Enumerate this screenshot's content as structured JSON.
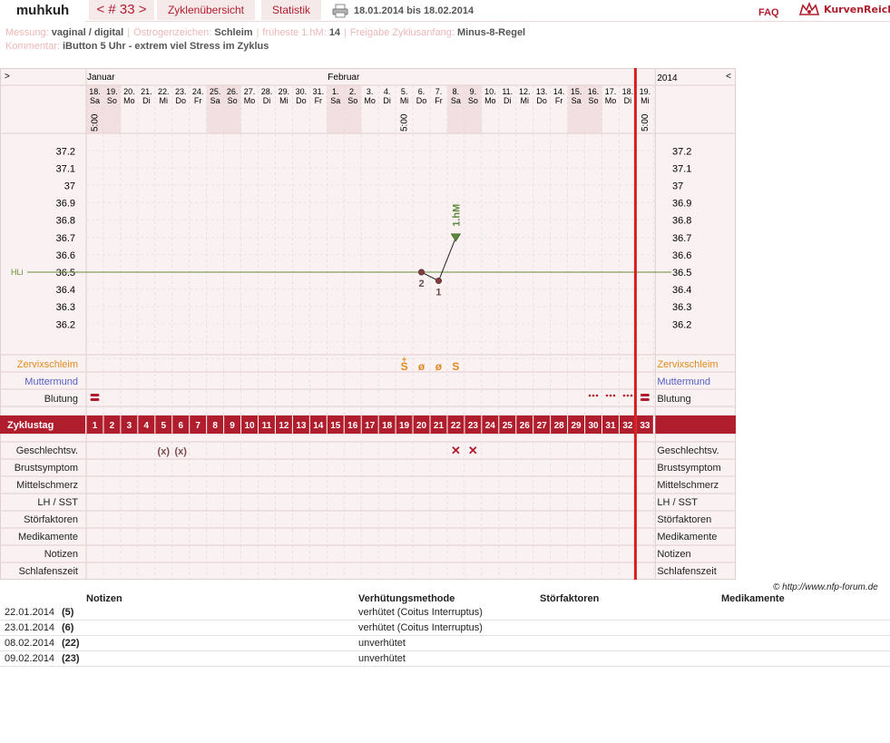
{
  "header": {
    "user": "muhkuh",
    "cycle": "< # 33 >",
    "tab_overview": "Zyklenübersicht",
    "tab_stats": "Statistik",
    "date_range": "18.01.2014 bis 18.02.2014",
    "faq": "FAQ",
    "logo_text": "KurvenReich"
  },
  "info": {
    "messung_label": "Messung:",
    "messung_value": "vaginal / digital",
    "oestrogen_label": "Östrogenzeichen:",
    "oestrogen_value": "Schleim",
    "hm_label": "früheste 1.hM:",
    "hm_value": "14",
    "freigabe_label": "Freigabe Zyklusanfang:",
    "freigabe_value": "Minus-8-Regel",
    "kommentar_label": "Kommentar:",
    "kommentar_value": "iButton 5 Uhr -  extrem viel Stress im Zyklus"
  },
  "colors": {
    "accent": "#b01e2e",
    "weekend_bg": "#f1dfe1",
    "grid_bg": "#faf2f2",
    "coverline": "#6b8e3a",
    "cervix": "#e08a1e",
    "muttermund": "#5560c0",
    "temp_line": "#222222",
    "hm_marker": "#5f8a3c"
  },
  "chart_data": {
    "type": "line",
    "year": "2014",
    "nav_left": ">",
    "nav_right": "<",
    "month_labels": [
      {
        "day_index": 1,
        "text": "Januar"
      },
      {
        "day_index": 15,
        "text": "Februar"
      }
    ],
    "dates": [
      "18.",
      "19.",
      "20.",
      "21.",
      "22.",
      "23.",
      "24.",
      "25.",
      "26.",
      "27.",
      "28.",
      "29.",
      "30.",
      "31.",
      "1.",
      "2.",
      "3.",
      "4.",
      "5.",
      "6.",
      "7.",
      "8.",
      "9.",
      "10.",
      "11.",
      "12.",
      "13.",
      "14.",
      "15.",
      "16.",
      "17.",
      "18.",
      "19."
    ],
    "weekdays": [
      "Sa",
      "So",
      "Mo",
      "Di",
      "Mi",
      "Do",
      "Fr",
      "Sa",
      "So",
      "Mo",
      "Di",
      "Mi",
      "Do",
      "Fr",
      "Sa",
      "So",
      "Mo",
      "Di",
      "Mi",
      "Do",
      "Fr",
      "Sa",
      "So",
      "Mo",
      "Di",
      "Mi",
      "Do",
      "Fr",
      "Sa",
      "So",
      "Mo",
      "Di",
      "Mi"
    ],
    "weekend_cycle_days": [
      1,
      2,
      8,
      9,
      15,
      16,
      22,
      23,
      29,
      30
    ],
    "time_labels": [
      {
        "cycle_day": 1,
        "text": "5:00"
      },
      {
        "cycle_day": 19,
        "text": "5:00"
      },
      {
        "cycle_day": 33,
        "text": "5:00"
      }
    ],
    "cycle_days": [
      1,
      2,
      3,
      4,
      5,
      6,
      7,
      8,
      9,
      10,
      11,
      12,
      13,
      14,
      15,
      16,
      17,
      18,
      19,
      20,
      21,
      22,
      23,
      24,
      25,
      26,
      27,
      28,
      29,
      30,
      31,
      32,
      33
    ],
    "today_cycle_day": 33,
    "ylim": [
      36.1,
      37.3
    ],
    "y_ticks": [
      "37.2",
      "37.1",
      "37",
      "36.9",
      "36.8",
      "36.7",
      "36.6",
      "36.5",
      "36.4",
      "36.3",
      "36.2"
    ],
    "coverline": {
      "value": 36.5,
      "label": "HLi"
    },
    "series": [
      {
        "points": [
          {
            "cycle_day": 20,
            "temp": 36.5
          },
          {
            "cycle_day": 21,
            "temp": 36.45
          },
          {
            "cycle_day": 22,
            "temp": 36.7
          }
        ]
      }
    ],
    "point_labels": [
      {
        "cycle_day": 20,
        "text": "2"
      },
      {
        "cycle_day": 21,
        "text": "1"
      }
    ],
    "hm_marker": {
      "cycle_day": 22,
      "text": "1.hM"
    },
    "row_labels": {
      "zervix": "Zervixschleim",
      "muttermund": "Muttermund",
      "blutung": "Blutung",
      "zyklustag": "Zyklustag",
      "geschlechtsverkehr": "Geschlechtsv.",
      "brust": "Brustsymptom",
      "mittelschmerz": "Mittelschmerz",
      "lh": "LH / SST",
      "stoer": "Störfaktoren",
      "medi": "Medikamente",
      "notizen": "Notizen",
      "schlaf": "Schlafenszeit"
    },
    "cervix": [
      {
        "cycle_day": 19,
        "text": "S",
        "mark": "+"
      },
      {
        "cycle_day": 20,
        "text": "ø"
      },
      {
        "cycle_day": 21,
        "text": "ø"
      },
      {
        "cycle_day": 22,
        "text": "S"
      }
    ],
    "bleeding": [
      {
        "cycle_day": 1,
        "type": "heavy"
      },
      {
        "cycle_day": 30,
        "type": "spotting"
      },
      {
        "cycle_day": 31,
        "type": "spotting"
      },
      {
        "cycle_day": 32,
        "type": "spotting"
      },
      {
        "cycle_day": 33,
        "type": "heavy"
      }
    ],
    "intercourse": [
      {
        "cycle_day": 5,
        "text": "(x)"
      },
      {
        "cycle_day": 6,
        "text": "(x)"
      },
      {
        "cycle_day": 22,
        "text": "✕"
      },
      {
        "cycle_day": 23,
        "text": "✕"
      }
    ]
  },
  "copyright": "© http://www.nfp-forum.de",
  "notes_table": {
    "headers": {
      "notizen": "Notizen",
      "methode": "Verhütungsmethode",
      "stoer": "Störfaktoren",
      "medi": "Medikamente"
    },
    "rows": [
      {
        "date": "22.01.2014",
        "day": "(5)",
        "method": "verhütet (Coitus Interruptus)"
      },
      {
        "date": "23.01.2014",
        "day": "(6)",
        "method": "verhütet (Coitus Interruptus)"
      },
      {
        "date": "08.02.2014",
        "day": "(22)",
        "method": "unverhütet"
      },
      {
        "date": "09.02.2014",
        "day": "(23)",
        "method": "unverhütet"
      }
    ]
  }
}
